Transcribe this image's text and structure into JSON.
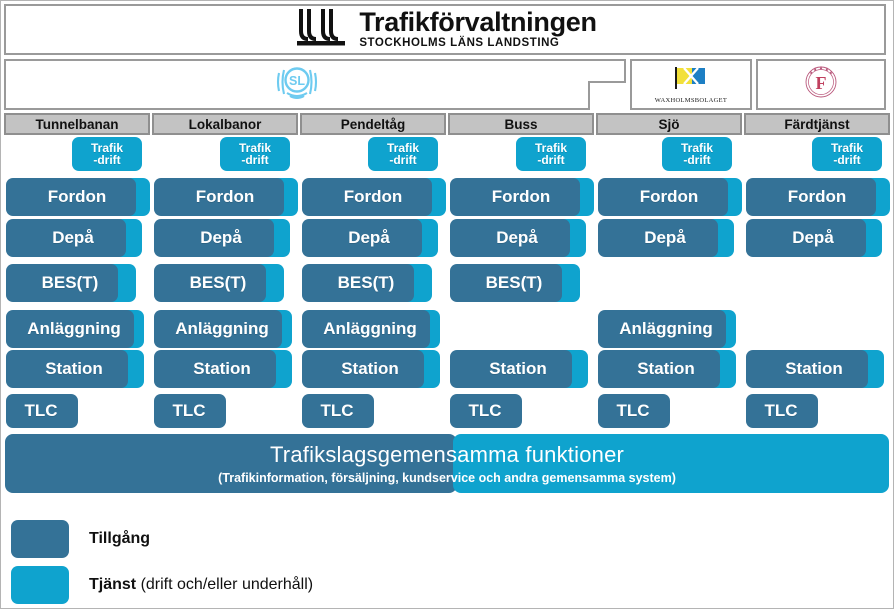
{
  "header": {
    "org_name": "Trafikförvaltningen",
    "org_subtitle": "STOCKHOLMS LÄNS LANDSTING",
    "logo_icon": "trafikforvaltningen-jll-mark-icon"
  },
  "operators": [
    {
      "id": "sl",
      "logo_icon": "sl-logo-icon",
      "caption": ""
    },
    {
      "id": "waxholmsbolaget",
      "logo_icon": "waxholmsbolaget-flag-icon",
      "caption": "WAXHOLMSBOLAGET"
    },
    {
      "id": "fardtjansten",
      "logo_icon": "fardtjansten-f-seal-icon",
      "caption": ""
    }
  ],
  "columns": [
    {
      "key": "tunnelbanan",
      "header": "Tunnelbanan",
      "rows": [
        {
          "label": "Trafik\n-drift",
          "line1": "Trafik",
          "line2": "-drift",
          "asset": false,
          "service": true
        },
        {
          "label": "Fordon",
          "asset": true,
          "service": true
        },
        {
          "label": "Depå",
          "asset": true,
          "service": true
        },
        {
          "label": "BES(T)",
          "asset": true,
          "service": true
        },
        {
          "label": "Anläggning",
          "asset": true,
          "service": true
        },
        {
          "label": "Station",
          "asset": true,
          "service": true
        },
        {
          "label": "TLC",
          "asset": true,
          "service": false
        }
      ]
    },
    {
      "key": "lokalbanor",
      "header": "Lokalbanor",
      "rows": [
        {
          "label": "Trafik\n-drift",
          "line1": "Trafik",
          "line2": "-drift",
          "asset": false,
          "service": true
        },
        {
          "label": "Fordon",
          "asset": true,
          "service": true
        },
        {
          "label": "Depå",
          "asset": true,
          "service": true
        },
        {
          "label": "BES(T)",
          "asset": true,
          "service": true
        },
        {
          "label": "Anläggning",
          "asset": true,
          "service": true
        },
        {
          "label": "Station",
          "asset": true,
          "service": true
        },
        {
          "label": "TLC",
          "asset": true,
          "service": false
        }
      ]
    },
    {
      "key": "pendeltag",
      "header": "Pendeltåg",
      "rows": [
        {
          "label": "Trafik\n-drift",
          "line1": "Trafik",
          "line2": "-drift",
          "asset": false,
          "service": true
        },
        {
          "label": "Fordon",
          "asset": true,
          "service": true
        },
        {
          "label": "Depå",
          "asset": true,
          "service": true
        },
        {
          "label": "BES(T)",
          "asset": true,
          "service": true
        },
        {
          "label": "Anläggning",
          "asset": true,
          "service": true
        },
        {
          "label": "Station",
          "asset": true,
          "service": true
        },
        {
          "label": "TLC",
          "asset": true,
          "service": false
        }
      ]
    },
    {
      "key": "buss",
      "header": "Buss",
      "rows": [
        {
          "label": "Trafik\n-drift",
          "line1": "Trafik",
          "line2": "-drift",
          "asset": false,
          "service": true
        },
        {
          "label": "Fordon",
          "asset": true,
          "service": true
        },
        {
          "label": "Depå",
          "asset": true,
          "service": true
        },
        {
          "label": "BES(T)",
          "asset": true,
          "service": true
        },
        {
          "label": "",
          "asset": false,
          "service": false
        },
        {
          "label": "Station",
          "asset": true,
          "service": true
        },
        {
          "label": "TLC",
          "asset": true,
          "service": false
        }
      ]
    },
    {
      "key": "sjo",
      "header": "Sjö",
      "rows": [
        {
          "label": "Trafik\n-drift",
          "line1": "Trafik",
          "line2": "-drift",
          "asset": false,
          "service": true
        },
        {
          "label": "Fordon",
          "asset": true,
          "service": true
        },
        {
          "label": "Depå",
          "asset": true,
          "service": true
        },
        {
          "label": "",
          "asset": false,
          "service": false
        },
        {
          "label": "Anläggning",
          "asset": true,
          "service": true
        },
        {
          "label": "Station",
          "asset": true,
          "service": true
        },
        {
          "label": "TLC",
          "asset": true,
          "service": false
        }
      ]
    },
    {
      "key": "fardtjanst",
      "header": "Färdtjänst",
      "rows": [
        {
          "label": "Trafik\n-drift",
          "line1": "Trafik",
          "line2": "-drift",
          "asset": false,
          "service": true
        },
        {
          "label": "Fordon",
          "asset": true,
          "service": true
        },
        {
          "label": "Depå",
          "asset": true,
          "service": true
        },
        {
          "label": "",
          "asset": false,
          "service": false
        },
        {
          "label": "",
          "asset": false,
          "service": false
        },
        {
          "label": "Station",
          "asset": true,
          "service": true
        },
        {
          "label": "TLC",
          "asset": true,
          "service": false
        }
      ]
    }
  ],
  "common_functions": {
    "title": "Trafikslagsgemensamma funktioner",
    "subtitle": "(Trafikinformation, försäljning, kundservice och andra gemensamma system)"
  },
  "legend": [
    {
      "key": "tillgang",
      "label": "Tillgång",
      "note": "",
      "color": "#347297"
    },
    {
      "key": "tjanst",
      "label": "Tjänst",
      "note": " (drift och/eller underhåll)",
      "color": "#0fa3ce"
    }
  ],
  "colors": {
    "asset": "#347297",
    "service": "#0fa3ce",
    "header_cell": "#c3c3c3",
    "header_border": "#8f8f8f",
    "band_border": "#9a9a9a",
    "background": "#ffffff"
  }
}
